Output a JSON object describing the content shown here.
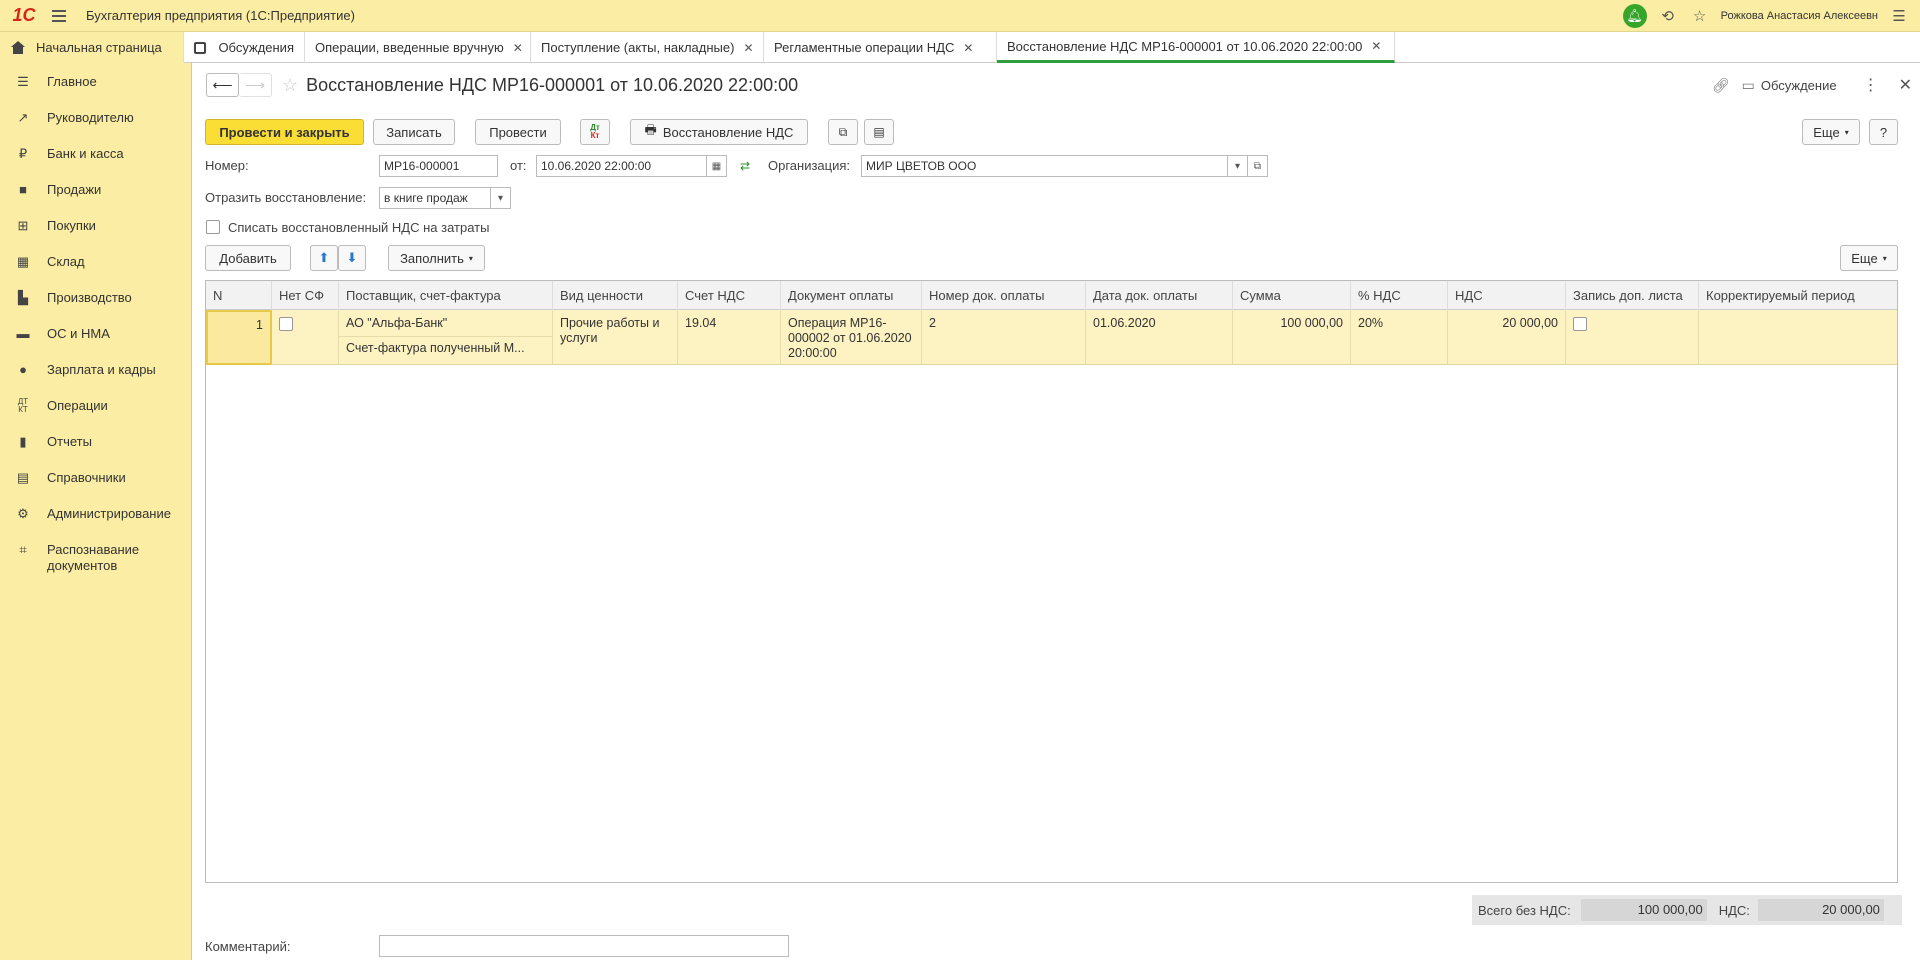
{
  "app": {
    "logo": "1С",
    "title": "Бухгалтерия предприятия  (1С:Предприятие)",
    "user": "Рожкова Анастасия Алексеевн"
  },
  "tabs": [
    {
      "label": "Начальная страница"
    },
    {
      "label": "Обсуждения"
    },
    {
      "label": "Операции, введенные вручную"
    },
    {
      "label": "Поступление (акты, накладные)"
    },
    {
      "label": "Регламентные операции НДС"
    },
    {
      "label": "Восстановление НДС МР16-000001 от 10.06.2020 22:00:00"
    }
  ],
  "sidebar": {
    "items": [
      {
        "label": "Главное",
        "icon": "menu-icon"
      },
      {
        "label": "Руководителю",
        "icon": "trend-icon"
      },
      {
        "label": "Банк и касса",
        "icon": "ruble-icon"
      },
      {
        "label": "Продажи",
        "icon": "bag-icon"
      },
      {
        "label": "Покупки",
        "icon": "cart-icon"
      },
      {
        "label": "Склад",
        "icon": "grid-icon"
      },
      {
        "label": "Производство",
        "icon": "factory-icon"
      },
      {
        "label": "ОС и НМА",
        "icon": "truck-icon"
      },
      {
        "label": "Зарплата и кадры",
        "icon": "person-icon"
      },
      {
        "label": "Операции",
        "icon": "dt-kt-icon"
      },
      {
        "label": "Отчеты",
        "icon": "chart-icon"
      },
      {
        "label": "Справочники",
        "icon": "book-icon"
      },
      {
        "label": "Администрирование",
        "icon": "gear-icon"
      },
      {
        "label": "Распознавание документов",
        "icon": "scan-icon"
      }
    ]
  },
  "document": {
    "title": "Восстановление НДС МР16-000001 от 10.06.2020 22:00:00",
    "discussion_label": "Обсуждение"
  },
  "toolbar": {
    "post_close": "Провести и закрыть",
    "save": "Записать",
    "post": "Провести",
    "dt": "Дт",
    "kt": "Кт",
    "print": "Восстановление НДС",
    "more": "Еще",
    "help": "?"
  },
  "form": {
    "number_label": "Номер:",
    "number_value": "МР16-000001",
    "date_label": "от:",
    "date_value": "10.06.2020 22:00:00",
    "org_label": "Организация:",
    "org_value": "МИР ЦВЕТОВ ООО",
    "reflect_label": "Отразить восстановление:",
    "reflect_value": "в книге продаж",
    "writeoff_label": "Списать восстановленный НДС на затраты"
  },
  "table_toolbar": {
    "add": "Добавить",
    "fill": "Заполнить",
    "more": "Еще"
  },
  "table": {
    "columns": [
      "N",
      "Нет СФ",
      "Поставщик, счет-фактура",
      "Вид ценности",
      "Счет НДС",
      "Документ оплаты",
      "Номер док. оплаты",
      "Дата док. оплаты",
      "Сумма",
      "% НДС",
      "НДС",
      "Запись доп. листа",
      "Корректируемый период"
    ],
    "rows": [
      {
        "n": "1",
        "supplier": "АО \"Альфа-Банк\"",
        "invoice": "Счет-фактура полученный М...",
        "value_type": "Прочие работы и услуги",
        "vat_account": "19.04",
        "payment_doc": "Операция МР16-000002 от 01.06.2020 20:00:00",
        "payment_num": "2",
        "payment_date": "01.06.2020",
        "sum": "100 000,00",
        "vat_rate": "20%",
        "vat": "20 000,00"
      }
    ]
  },
  "totals": {
    "without_vat_label": "Всего без НДС:",
    "without_vat_value": "100 000,00",
    "vat_label": "НДС:",
    "vat_value": "20 000,00"
  },
  "comment": {
    "label": "Комментарий:",
    "value": ""
  }
}
